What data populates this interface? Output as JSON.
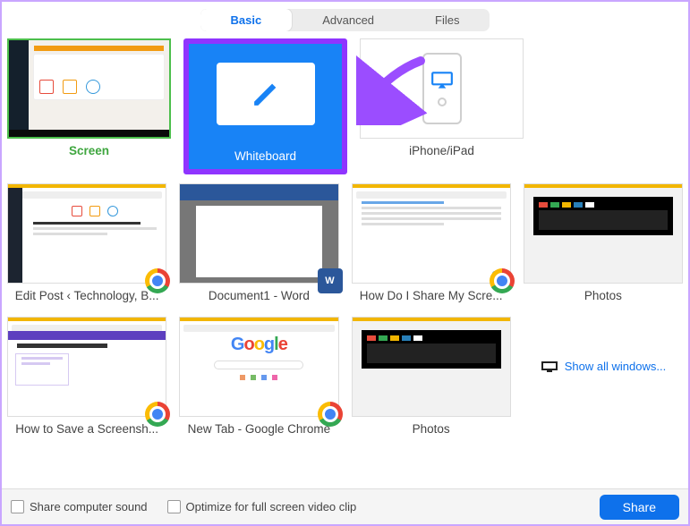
{
  "tabs": {
    "basic": "Basic",
    "advanced": "Advanced",
    "files": "Files"
  },
  "sources": {
    "screen": "Screen",
    "whiteboard": "Whiteboard",
    "iphone": "iPhone/iPad"
  },
  "windows": {
    "editpost": "Edit Post ‹ Technology, B...",
    "doc1": "Document1 - Word",
    "howshare": "How Do I Share My Scre...",
    "photos1": "Photos",
    "savescreen": "How to Save a Screensh...",
    "newtab": "New Tab - Google Chrome",
    "photos2": "Photos"
  },
  "show_all": "Show all windows...",
  "google": "Google",
  "word_badge": "W",
  "footer": {
    "share_sound": "Share computer sound",
    "optimize": "Optimize for full screen video clip",
    "share_btn": "Share"
  }
}
